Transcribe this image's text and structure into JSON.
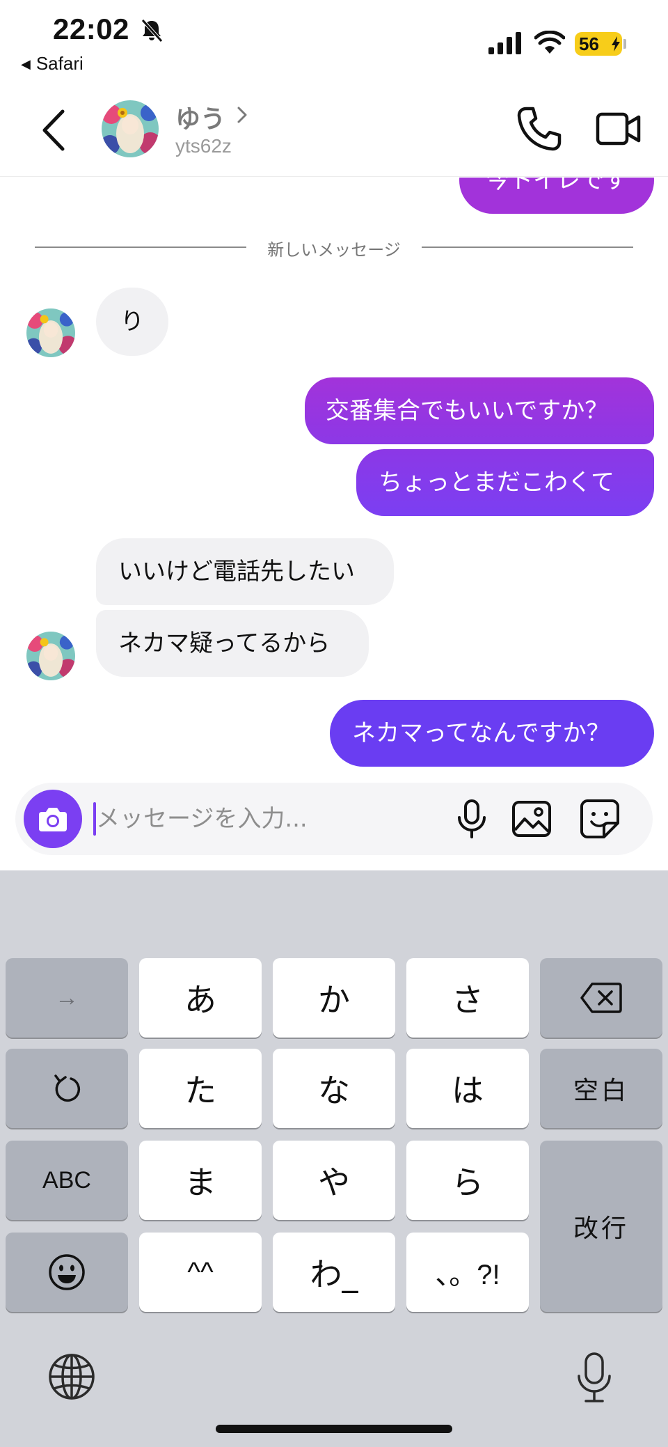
{
  "status_bar": {
    "time": "22:02",
    "back_app": "Safari",
    "battery": "56",
    "battery_color": "#f7cd1a"
  },
  "header": {
    "contact_name": "ゆう",
    "contact_handle": "yts62z"
  },
  "chat": {
    "partial_message": "今トイレです",
    "divider": "新しいメッセージ",
    "messages": [
      {
        "side": "in",
        "text": "り"
      },
      {
        "side": "out",
        "text": "交番集合でもいいですか？"
      },
      {
        "side": "out",
        "text": "ちょっとまだこわくて"
      },
      {
        "side": "in",
        "text": "いいけど電話先したい"
      },
      {
        "side": "in",
        "text": "ネカマ疑ってるから"
      },
      {
        "side": "out",
        "text": "ネカマってなんですか？"
      }
    ],
    "colors": {
      "outgoing_top": "#a233da",
      "outgoing_bottom": "#6a3df2",
      "incoming": "#f1f1f3",
      "accent": "#7b3ff2"
    }
  },
  "composer": {
    "placeholder": "メッセージを入力..."
  },
  "keyboard": {
    "row1": [
      "→",
      "あ",
      "か",
      "さ",
      "backspace"
    ],
    "row2": [
      "undo",
      "た",
      "な",
      "は",
      "空白"
    ],
    "row3": [
      "ABC",
      "ま",
      "や",
      "ら",
      "改行"
    ],
    "row4": [
      "emoji",
      "^^",
      "わ_",
      "、。?!"
    ]
  }
}
